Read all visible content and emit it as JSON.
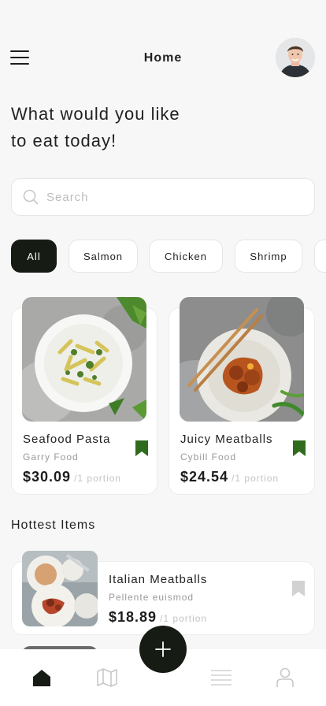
{
  "header": {
    "title": "Home"
  },
  "greeting": {
    "line1": "What would you like",
    "line2": "to eat today!"
  },
  "search": {
    "placeholder": "Search"
  },
  "categories": [
    "All",
    "Salmon",
    "Chicken",
    "Shrimp"
  ],
  "featured": [
    {
      "name": "Seafood Pasta",
      "brand": "Garry Food",
      "price": "$30.09",
      "unit": "/1 portion",
      "bookmarked": true
    },
    {
      "name": "Juicy Meatballs",
      "brand": "Cybill Food",
      "price": "$24.54",
      "unit": "/1 portion",
      "bookmarked": true
    }
  ],
  "hottest": {
    "title": "Hottest Items",
    "items": [
      {
        "name": "Italian Meatballs",
        "brand": "Pellente euismod",
        "price": "$18.89",
        "unit": "/1 portion",
        "bookmarked": false
      }
    ]
  },
  "colors": {
    "accent": "#161b13",
    "bookmark_active": "#2f6b1d",
    "bookmark_inactive": "#d2d2d2"
  },
  "tabbar": {
    "icons": [
      "home-icon",
      "map-icon",
      "add-icon",
      "list-icon",
      "profile-icon"
    ],
    "active": "home-icon"
  }
}
